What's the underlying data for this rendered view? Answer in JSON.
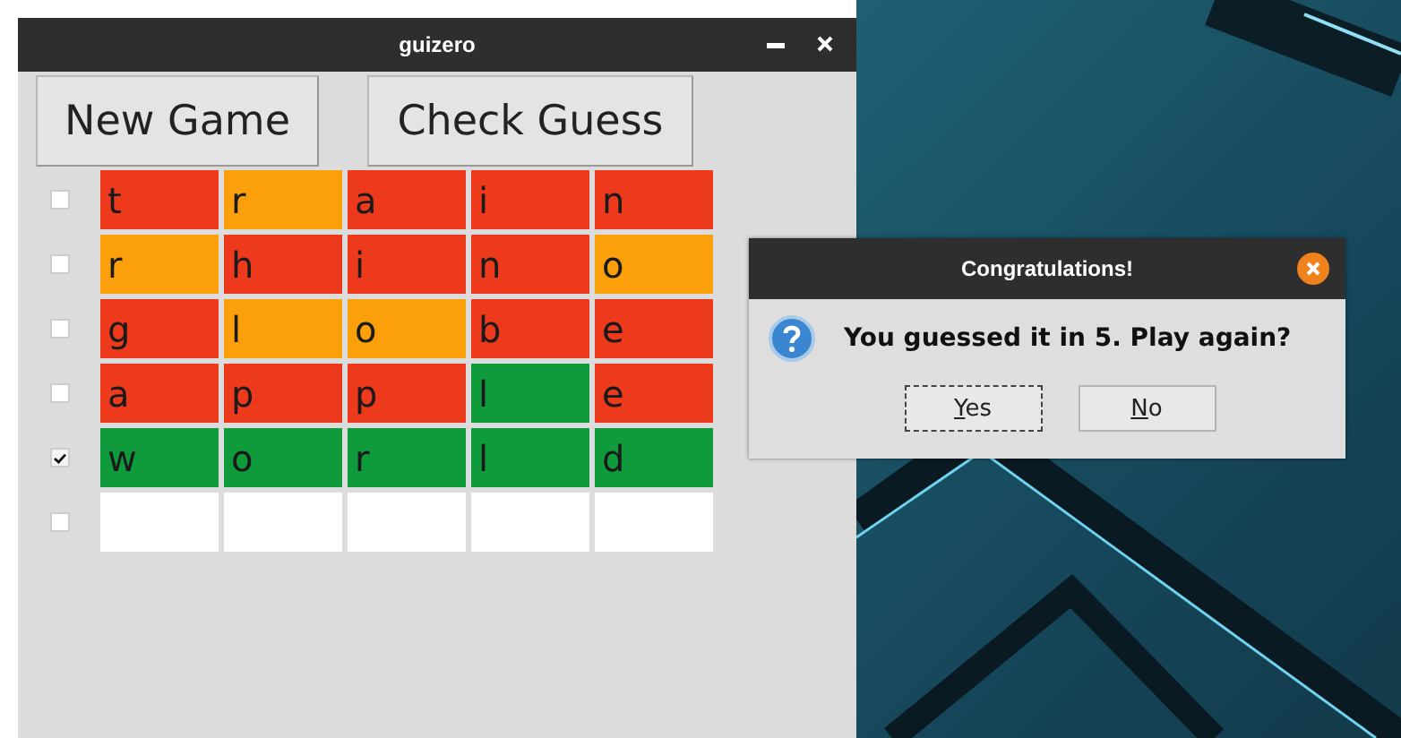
{
  "window": {
    "title": "guizero"
  },
  "buttons": [
    "New Game",
    "Check Guess"
  ],
  "rows": [
    {
      "checked": false,
      "cells": [
        {
          "letter": "t",
          "color": "#ee3a1c"
        },
        {
          "letter": "r",
          "color": "#fba00a"
        },
        {
          "letter": "a",
          "color": "#ee3a1c"
        },
        {
          "letter": "i",
          "color": "#ee3a1c"
        },
        {
          "letter": "n",
          "color": "#ee3a1c"
        }
      ]
    },
    {
      "checked": false,
      "cells": [
        {
          "letter": "r",
          "color": "#fba00a"
        },
        {
          "letter": "h",
          "color": "#ee3a1c"
        },
        {
          "letter": "i",
          "color": "#ee3a1c"
        },
        {
          "letter": "n",
          "color": "#ee3a1c"
        },
        {
          "letter": "o",
          "color": "#fba00a"
        }
      ]
    },
    {
      "checked": false,
      "cells": [
        {
          "letter": "g",
          "color": "#ee3a1c"
        },
        {
          "letter": "l",
          "color": "#fba00a"
        },
        {
          "letter": "o",
          "color": "#fba00a"
        },
        {
          "letter": "b",
          "color": "#ee3a1c"
        },
        {
          "letter": "e",
          "color": "#ee3a1c"
        }
      ]
    },
    {
      "checked": false,
      "cells": [
        {
          "letter": "a",
          "color": "#ee3a1c"
        },
        {
          "letter": "p",
          "color": "#ee3a1c"
        },
        {
          "letter": "p",
          "color": "#ee3a1c"
        },
        {
          "letter": "l",
          "color": "#0f9a3c"
        },
        {
          "letter": "e",
          "color": "#ee3a1c"
        }
      ]
    },
    {
      "checked": true,
      "cells": [
        {
          "letter": "w",
          "color": "#0f9a3c"
        },
        {
          "letter": "o",
          "color": "#0f9a3c"
        },
        {
          "letter": "r",
          "color": "#0f9a3c"
        },
        {
          "letter": "l",
          "color": "#0f9a3c"
        },
        {
          "letter": "d",
          "color": "#0f9a3c"
        }
      ]
    },
    {
      "checked": false,
      "cells": [
        {
          "color": "#ffffff"
        },
        {
          "color": "#ffffff"
        },
        {
          "color": "#ffffff"
        },
        {
          "color": "#ffffff"
        },
        {
          "color": "#ffffff"
        }
      ]
    }
  ],
  "dialog": {
    "title": "Congratulations!",
    "message": "You guessed it in 5. Play again?",
    "buttons": [
      {
        "label": "Yes",
        "focused": true
      },
      {
        "label": "No",
        "focused": false
      }
    ]
  }
}
